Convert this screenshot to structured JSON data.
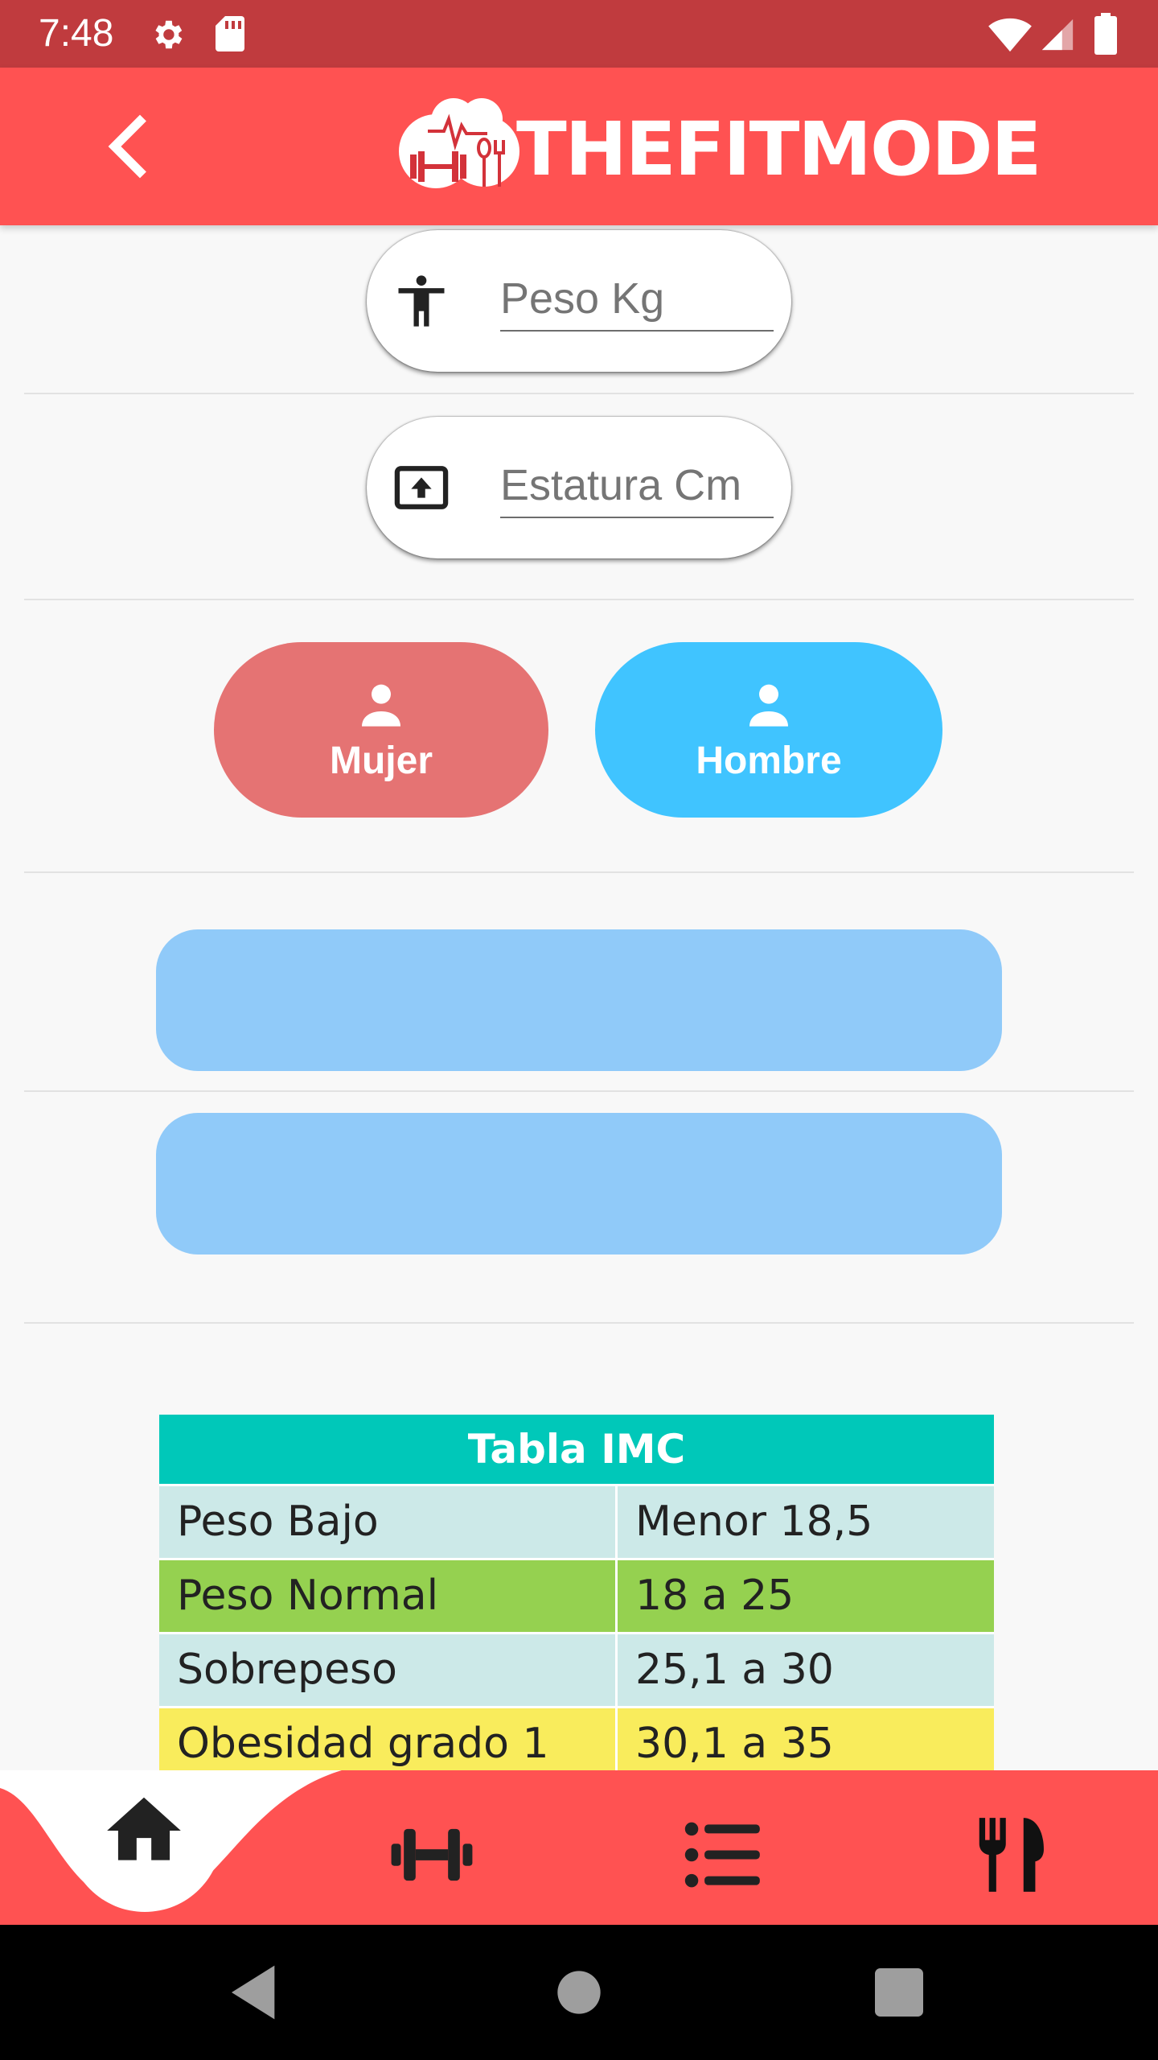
{
  "status_bar": {
    "time": "7:48",
    "icons": [
      "settings-icon",
      "sd-card-icon",
      "wifi-icon",
      "cell-signal-icon",
      "battery-icon"
    ]
  },
  "app_bar": {
    "back_icon": "chevron-left-icon",
    "logo_text": "THEFITMODE",
    "background": "#ff5252"
  },
  "form": {
    "weight": {
      "placeholder": "Peso Kg",
      "value": "",
      "icon": "accessibility-icon"
    },
    "height": {
      "placeholder": "Estatura Cm",
      "value": "",
      "icon": "upload-box-icon"
    }
  },
  "gender": {
    "female": {
      "label": "Mujer",
      "icon": "person-icon",
      "color": "#e57373"
    },
    "male": {
      "label": "Hombre",
      "icon": "person-icon",
      "color": "#40c4ff"
    }
  },
  "results": {
    "box1_text": "",
    "box2_text": "",
    "color": "#90caf9"
  },
  "imc_table": {
    "title": "Tabla IMC",
    "rows": [
      {
        "category": "Peso Bajo",
        "range": "Menor 18,5",
        "color": "#cce9e8"
      },
      {
        "category": "Peso Normal",
        "range": "18 a 25",
        "color": "#95d150"
      },
      {
        "category": "Sobrepeso",
        "range": "25,1 a 30",
        "color": "#cce9e8"
      },
      {
        "category": "Obesidad grado 1",
        "range": "30,1 a 35",
        "color": "#f9ec5c"
      }
    ]
  },
  "bottom_nav": {
    "items": [
      "home-icon",
      "dumbbell-icon",
      "list-icon",
      "utensils-icon"
    ],
    "active": "home-icon"
  },
  "system_nav": {
    "items": [
      "back-triangle-icon",
      "home-circle-icon",
      "recents-square-icon"
    ]
  }
}
